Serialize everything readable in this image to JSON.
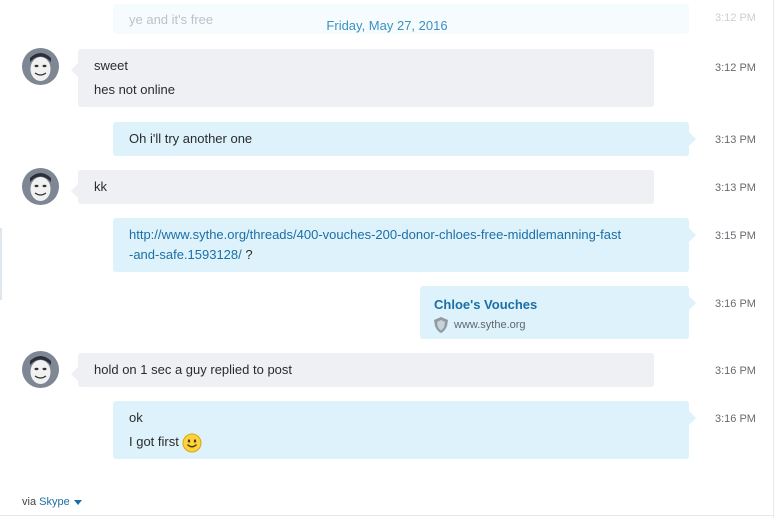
{
  "faded_message": {
    "text": "ye and it's free",
    "time": "3:12 PM"
  },
  "date_separator": "Friday, May 27, 2016",
  "messages": [
    {
      "direction": "in",
      "lines": [
        "sweet",
        "hes not online"
      ],
      "time": "3:12 PM"
    },
    {
      "direction": "out",
      "lines": [
        "Oh i'll try another one"
      ],
      "time": "3:13 PM"
    },
    {
      "direction": "in",
      "lines": [
        "kk"
      ],
      "time": "3:13 PM"
    },
    {
      "direction": "out",
      "link_lines": [
        "http://www.sythe.org/threads/400-vouches-200-donor-chloes-free-middlemanning-fast",
        "-and-safe.1593128/"
      ],
      "link_suffix": " ?",
      "time": "3:15 PM"
    },
    {
      "direction": "out",
      "preview_title": "Chloe's Vouches",
      "preview_site": "www.sythe.org",
      "time": "3:16 PM"
    },
    {
      "direction": "in",
      "lines": [
        "hold on 1 sec a guy replied to post"
      ],
      "time": "3:16 PM"
    },
    {
      "direction": "out",
      "lines": [
        "ok",
        "I got first"
      ],
      "emoji": "smiley-emoticon",
      "time": "3:16 PM"
    }
  ],
  "footer": {
    "via_label": "via",
    "service": "Skype"
  },
  "colors": {
    "incoming_bubble": "#eef0f3",
    "outgoing_bubble": "#def2fb",
    "link": "#1b6fa6",
    "date": "#3a91c4"
  }
}
